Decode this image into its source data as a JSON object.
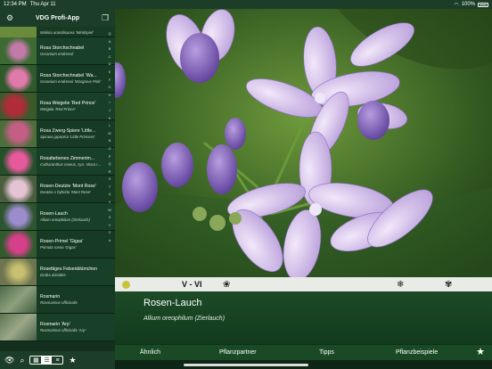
{
  "status": {
    "time": "12:34 PM",
    "date": "Thu Apr 11",
    "battery": "100%"
  },
  "sidebar": {
    "title": "VDG Profi-App",
    "items": [
      {
        "latin": "Molinia arundinacea 'Windspiel'",
        "color": "#6a8b3c"
      },
      {
        "name": "Rosa Storchschnabel",
        "latin": "Geranium endressii",
        "color": "#b96a9a"
      },
      {
        "name": "Rosa Storchschnabel 'Wa...",
        "latin": "Geranium endressii 'Wargrave Pink'",
        "color": "#d46c9c"
      },
      {
        "name": "Rosa Weigelie 'Red Prince'",
        "latin": "Weigela 'Red Prince'",
        "color": "#b02c3a"
      },
      {
        "name": "Rosa Zwerg-Spiere 'Little...",
        "latin": "Spiraea japonica 'Little Princess'",
        "color": "#c35f84"
      },
      {
        "name": "Rosafarbenes Zimmerim...",
        "latin": "Catharanthus roseus, syn. Vinca rosea",
        "color": "#d64f8e"
      },
      {
        "name": "Rosen-Deutzie 'Mont Rose'",
        "latin": "Deutzia x hybrida 'Mont Rose'",
        "color": "#c890a8"
      },
      {
        "name": "Rosen-Lauch",
        "latin": "Allium oreophilum (Zierlauch)",
        "color": "#7a6ca8"
      },
      {
        "name": "Rosen-Primel 'Gigas'",
        "latin": "Primula rosea 'Gigas'",
        "color": "#d6408a"
      },
      {
        "name": "Rosettiges Felsenblümchen",
        "latin": "Draba aizoides",
        "color": "#7f8a58"
      },
      {
        "name": "Rosmarin",
        "latin": "Rosmarinus officinalis",
        "color": "#5c7a5a"
      },
      {
        "name": "Rosmarin 'Arp'",
        "latin": "Rosmarinus officinalis 'Arp'",
        "color": "#6f8060"
      }
    ],
    "alphabet": [
      "Q",
      "A",
      "B",
      "C",
      "D",
      "E",
      "F",
      "G",
      "H",
      "I",
      "J",
      "K",
      "L",
      "M",
      "N",
      "O",
      "P",
      "Q",
      "R",
      "S",
      "T",
      "U",
      "V",
      "W",
      "X",
      "Y",
      "Z",
      "#"
    ]
  },
  "info": {
    "months": "V - VI"
  },
  "plant": {
    "name": "Rosen-Lauch",
    "latin": "Allium oreophilum (Zierlauch)"
  },
  "tabs": [
    "Ähnlich",
    "Pflanzpartner",
    "Tipps",
    "Pflanzbeispiele"
  ],
  "colors": {
    "accent": "#1c3d27",
    "flower": "#c8b4e6"
  }
}
